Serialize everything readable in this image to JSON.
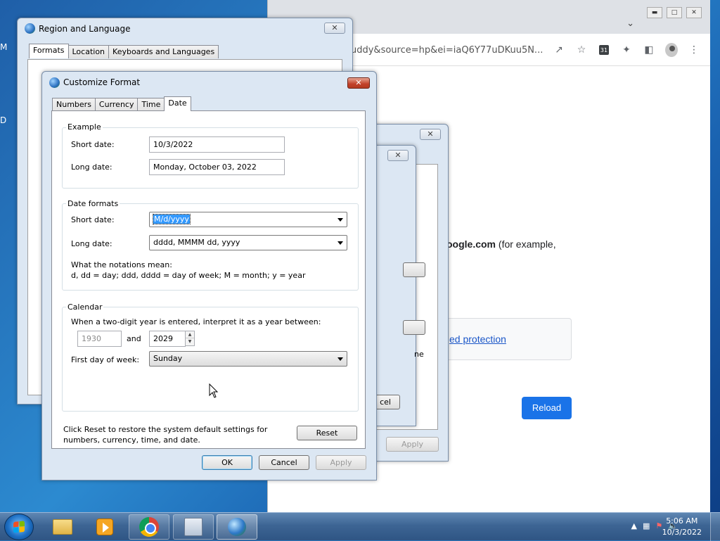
{
  "desktop": {
    "icon_label_1": "M",
    "icon_label_2": "D"
  },
  "browser": {
    "url": "uddy&source=hp&ei=iaQ6Y77uDKuu5N...",
    "text_bold": "oogle.com",
    "text_rest": " (for example,",
    "link": "ed protection",
    "reload": "Reload",
    "calendar_icon_text": "31"
  },
  "region_dialog": {
    "title": "Region and Language",
    "tabs": [
      "Formats",
      "Location",
      "Keyboards and Languages"
    ]
  },
  "mid_dialog": {
    "partial_apply": "Apply",
    "partial_cancel": "cel",
    "partial_text": "ne"
  },
  "customize": {
    "title": "Customize Format",
    "tabs": [
      "Numbers",
      "Currency",
      "Time",
      "Date"
    ],
    "example": {
      "legend": "Example",
      "short_label": "Short date:",
      "short_value": "10/3/2022",
      "long_label": "Long date:",
      "long_value": "Monday, October 03, 2022"
    },
    "formats": {
      "legend": "Date formats",
      "short_label": "Short date:",
      "short_value": "M/d/yyyy",
      "long_label": "Long date:",
      "long_value": "dddd, MMMM dd, yyyy",
      "notation_title": "What the notations mean:",
      "notation_text": "d, dd = day;  ddd, dddd = day of week;  M = month;  y = year"
    },
    "calendar": {
      "legend": "Calendar",
      "two_digit_text": "When a two-digit year is entered, interpret it as a year between:",
      "year_from": "1930",
      "and_label": "and",
      "year_to": "2029",
      "first_day_label": "First day of week:",
      "first_day_value": "Sunday"
    },
    "reset_text_1": "Click Reset to restore the system default settings for",
    "reset_text_2": "numbers, currency, time, and date.",
    "reset": "Reset",
    "ok": "OK",
    "cancel": "Cancel",
    "apply": "Apply"
  },
  "taskbar": {
    "time": "5:06 AM",
    "date": "10/3/2022"
  }
}
